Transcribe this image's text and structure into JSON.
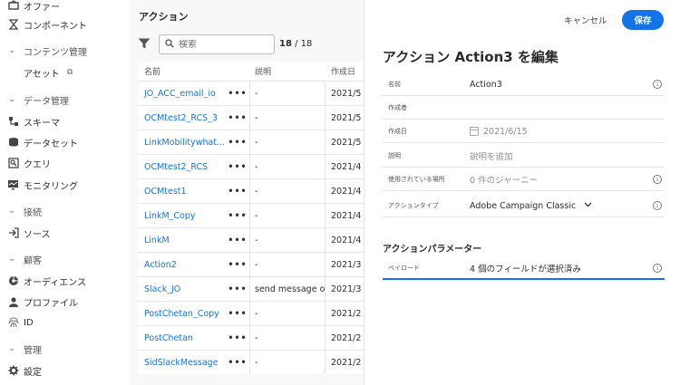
{
  "sidebar": {
    "items": [
      {
        "label": "オファー",
        "icon": "offer-icon"
      },
      {
        "label": "コンポーネント",
        "icon": "component-icon"
      },
      {
        "label": "コンテンツ管理",
        "section": true
      },
      {
        "label": "アセット",
        "icon": "external-link-icon",
        "external": "⧉"
      },
      {
        "label": "データ管理",
        "section": true
      },
      {
        "label": "スキーマ",
        "icon": "schema-icon"
      },
      {
        "label": "データセット",
        "icon": "dataset-icon"
      },
      {
        "label": "クエリ",
        "icon": "query-icon"
      },
      {
        "label": "モニタリング",
        "icon": "monitoring-icon"
      },
      {
        "label": "接続",
        "section": true
      },
      {
        "label": "ソース",
        "icon": "source-icon"
      },
      {
        "label": "顧客",
        "section": true
      },
      {
        "label": "オーディエンス",
        "icon": "audience-icon"
      },
      {
        "label": "プロファイル",
        "icon": "profile-icon"
      },
      {
        "label": "ID",
        "icon": "id-icon"
      },
      {
        "label": "管理",
        "section": true
      },
      {
        "label": "設定",
        "icon": "settings-icon"
      }
    ]
  },
  "main": {
    "title": "アクション",
    "search_placeholder": "検索",
    "count_shown": "18",
    "count_sep": " / ",
    "count_total": "18",
    "columns": {
      "name": "名前",
      "desc": "説明",
      "date": "作成日"
    },
    "more": "•••",
    "rows": [
      {
        "name": "JO_ACC_email_io",
        "desc": "-",
        "date": "2021/5"
      },
      {
        "name": "OCMtest2_RCS_3",
        "desc": "-",
        "date": "2021/5"
      },
      {
        "name": "LinkMobilitywhat...",
        "desc": "-",
        "date": "2021/5"
      },
      {
        "name": "OCMtest2_RCS",
        "desc": "-",
        "date": "2021/4"
      },
      {
        "name": "OCMtest1",
        "desc": "-",
        "date": "2021/4"
      },
      {
        "name": "LinkM_Copy",
        "desc": "-",
        "date": "2021/4"
      },
      {
        "name": "LinkM",
        "desc": "-",
        "date": "2021/4"
      },
      {
        "name": "Action2",
        "desc": "-",
        "date": "2021/3"
      },
      {
        "name": "Slack_JO",
        "desc": "send message on bsc",
        "date": "2021/3"
      },
      {
        "name": "PostChetan_Copy",
        "desc": "-",
        "date": "2021/2"
      },
      {
        "name": "PostChetan",
        "desc": "-",
        "date": "2021/2"
      },
      {
        "name": "SidSlackMessage",
        "desc": "-",
        "date": "2021/2"
      }
    ]
  },
  "panel": {
    "cancel": "キャンセル",
    "save": "保存",
    "title": "アクション Action3 を編集",
    "info_glyph": "i",
    "fields": {
      "name": {
        "label": "名前",
        "value": "Action3"
      },
      "creator": {
        "label": "作成者",
        "value": ""
      },
      "created": {
        "label": "作成日",
        "value": "2021/6/15"
      },
      "description": {
        "label": "説明",
        "value": "説明を追加"
      },
      "used_in": {
        "label": "使用されている場所",
        "value": "0 件のジャーニー"
      },
      "action_type": {
        "label": "アクションタイプ",
        "value": "Adobe Campaign Classic"
      }
    },
    "params_title": "アクションパラメーター",
    "payload": {
      "label": "ペイロード",
      "value": "4 個のフィールドが選択済み"
    }
  },
  "colors": {
    "accent": "#1473e6",
    "text": "#2c2c2c",
    "list_bg": "#f8f8f8"
  }
}
